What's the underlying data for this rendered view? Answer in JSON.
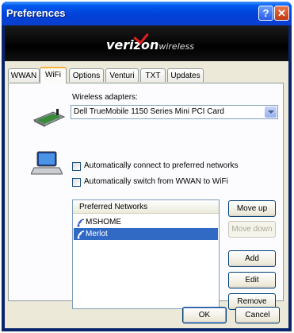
{
  "window": {
    "title": "Preferences",
    "help_glyph": "?",
    "close_glyph": "✕"
  },
  "banner": {
    "brand_pre": "veri",
    "brand_mid": "z",
    "brand_post": "on",
    "brand_sub": "wireless"
  },
  "tabs": [
    {
      "label": "WWAN",
      "active": false
    },
    {
      "label": "WiFi",
      "active": true
    },
    {
      "label": "Options",
      "active": false
    },
    {
      "label": "Venturi",
      "active": false
    },
    {
      "label": "TXT",
      "active": false
    },
    {
      "label": "Updates",
      "active": false
    }
  ],
  "wifi": {
    "adapters_label": "Wireless adapters:",
    "adapter_selected": "Dell TrueMobile 1150 Series Mini PCI Card",
    "auto_connect_label": "Automatically connect to preferred networks",
    "auto_connect_checked": false,
    "auto_switch_label": "Automatically switch from WWAN to WiFi",
    "auto_switch_checked": false,
    "networks_header": "Preferred Networks",
    "networks": [
      {
        "name": "MSHOME",
        "selected": false
      },
      {
        "name": "Merlot",
        "selected": true
      }
    ],
    "buttons": {
      "move_up": "Move up",
      "move_down": "Move down",
      "add": "Add",
      "edit": "Edit",
      "remove": "Remove"
    }
  },
  "footer": {
    "ok": "OK",
    "cancel": "Cancel"
  },
  "colors": {
    "title_bar": "#0054e3",
    "selection": "#316ac5",
    "active_tab_accent": "#f7b33d",
    "brand_accent": "#e0201c"
  }
}
